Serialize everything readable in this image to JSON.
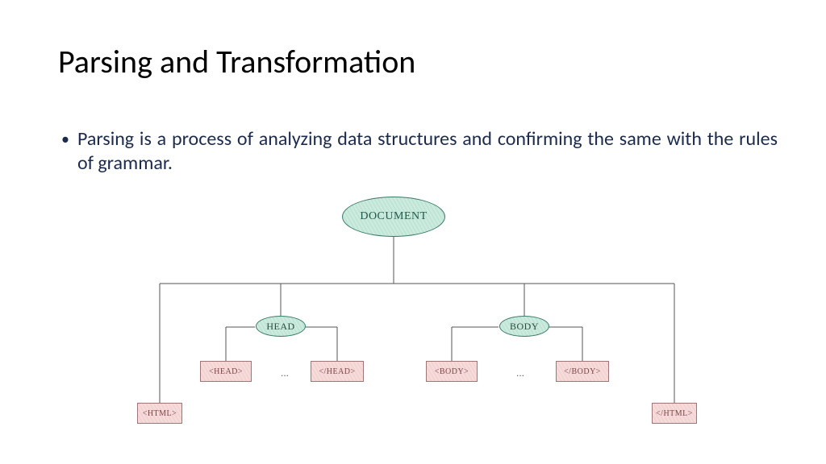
{
  "title": "Parsing and Transformation",
  "bullet": "Parsing is a process of analyzing data structures and confirming the same with the rules of grammar.",
  "diagram": {
    "root": "DOCUMENT",
    "head": "HEAD",
    "body": "BODY",
    "open_head": "<HEAD>",
    "close_head": "</HEAD>",
    "open_body": "<BODY>",
    "close_body": "</BODY>",
    "open_html": "<HTML>",
    "close_html": "</HTML>",
    "ellipsis": "..."
  }
}
